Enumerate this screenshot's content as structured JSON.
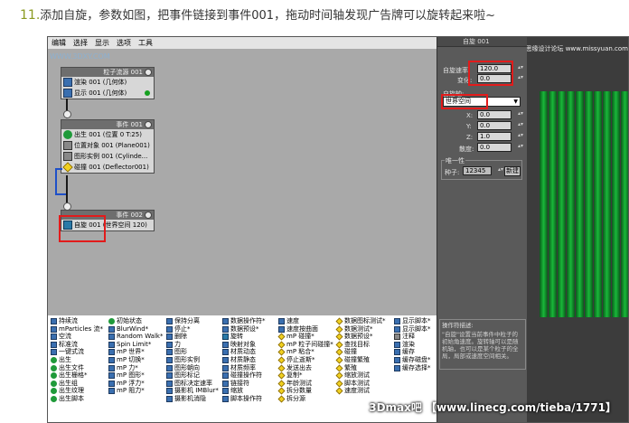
{
  "caption": {
    "number": "11.",
    "text": "添加自旋，参数如图，把事件链接到事件001，拖动时间轴发现广告牌可以旋转起来啦~"
  },
  "menu": [
    "编辑",
    "选择",
    "显示",
    "选项",
    "工具"
  ],
  "viewport": {
    "watermark": "WWW.3DXY.COM",
    "nodes": {
      "particle_flow": {
        "header": "粒子流源 001",
        "rows": [
          {
            "label": "渲染 001 (几何体)"
          },
          {
            "label": "显示 001 (几何体)"
          }
        ]
      },
      "event001": {
        "header": "事件 001",
        "rows": [
          {
            "label": "出生 001 (位置 0 T:25)"
          },
          {
            "label": "位置对象 001 (Plane001)"
          },
          {
            "label": "图形实例 001 (Cylinde..."
          },
          {
            "label": "碰撞 001 (Deflector001)"
          }
        ]
      },
      "event002": {
        "header": "事件 002",
        "rows": [
          {
            "label": "自旋 001 (世界空间 120)"
          }
        ]
      }
    }
  },
  "depot": {
    "columns": [
      [
        "持续流",
        "mParticles 流*",
        "空流",
        "标准流",
        "一键式流",
        "出生",
        "出生文件",
        "出生栅格*",
        "出生组",
        "出生纹理",
        "出生脚本"
      ],
      [
        "初始状态",
        "BlurWind*",
        "Random Walk*",
        "Spin Limit*",
        "mP 世界*",
        "mP 切换*",
        "mP 力*",
        "mP 图形*",
        "mP 浮力*",
        "mP 阻力*"
      ],
      [
        "保持分离",
        "停止*",
        "删除",
        "力",
        "图形",
        "图形实例",
        "图形朝向",
        "图形标记",
        "图标决定速率",
        "摄影机 IMBlur*",
        "摄影机消隐"
      ],
      [
        "数据操作符*",
        "数据预设*",
        "旋转",
        "映射对象",
        "材质动态",
        "材质静态",
        "材质频率",
        "碰撞操作符",
        "链接符",
        "缩放",
        "脚本操作符"
      ],
      [
        "速度",
        "速度按曲面",
        "mP 碰撞*",
        "mP 粒子间碰撞*",
        "mP 粘合*",
        "停止逝斯*",
        "发送出去",
        "复制*",
        "年龄测试",
        "拆分数量",
        "拆分源"
      ],
      [
        "数据图标测试*",
        "数据测试*",
        "数据预设*",
        "查找目标",
        "碰撞",
        "碰撞繁殖",
        "繁殖",
        "缩放测试",
        "脚本测试",
        "速度测试"
      ],
      [
        "显示脚本*",
        "显示脚本*",
        "注释",
        "渲染",
        "缓存",
        "缓存磁盘*",
        "缓存选择*"
      ]
    ]
  },
  "panel": {
    "title": "自旋 001",
    "spin_rate_label": "自旋速率:",
    "spin_rate_value": "120.0",
    "variation_label": "变化:",
    "variation_value": "0.0",
    "axis_label": "自旋轴:",
    "axis_value": "世界空间",
    "x_label": "X:",
    "x_value": "0.0",
    "y_label": "Y:",
    "y_value": "0.0",
    "z_label": "Z:",
    "z_value": "1.0",
    "div_label": "散度:",
    "div_value": "0.0",
    "unique_group": "唯一性",
    "seed_label": "种子:",
    "seed_value": "12345",
    "new_button": "新建",
    "desc_title": "操作符描述:",
    "desc_text": "\"自旋\"设置当前事件中粒子的初始角速度。旋转轴可以是随机轴，也可以是某个粒子的全局，局部或速度空间相关。"
  },
  "scene": {
    "watermark": "思缘设计论坛 www.missyuan.com"
  },
  "footer_watermark": "3Dmax吧 【www.linecg.com/tieba/1771】",
  "colors": {
    "accent_red": "#e21b1b",
    "curtain_green": "#19b83a",
    "caption_number": "#8a9a20"
  }
}
